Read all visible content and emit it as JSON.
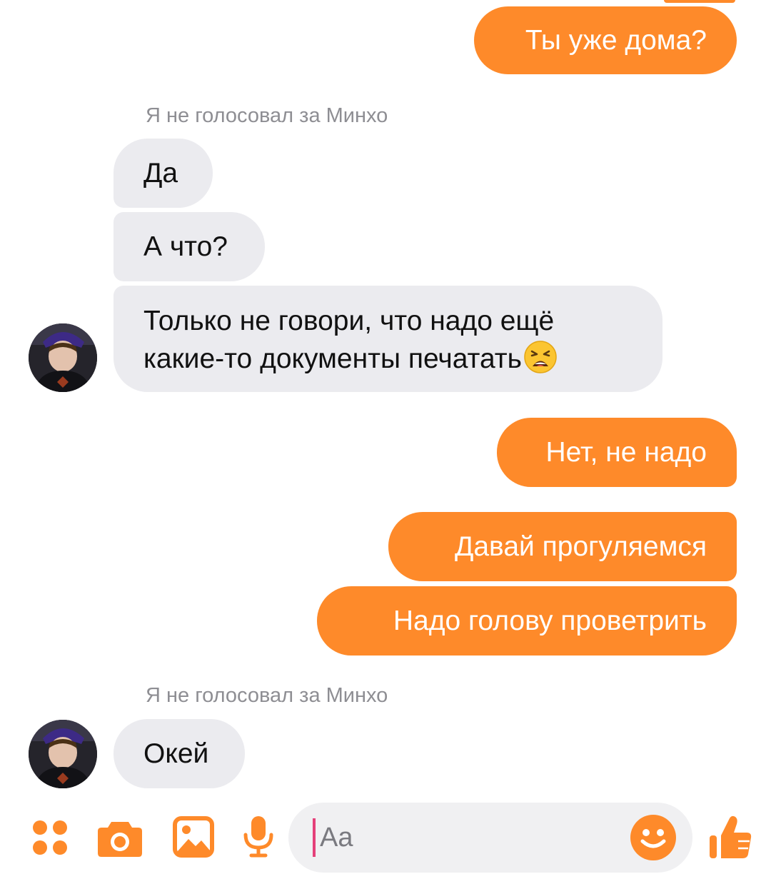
{
  "conversation": {
    "messages": [
      {
        "text": "Ты уже дома?"
      },
      {
        "text": "Да"
      },
      {
        "text": "А что?"
      },
      {
        "line1": "Только не говори, что надо ещё",
        "line2": "какие-то документы печатать",
        "emoji": "weary-face-emoji"
      },
      {
        "text": "Нет, не надо"
      },
      {
        "text": "Давай прогуляемся"
      },
      {
        "text": "Надо голову проветрить"
      },
      {
        "text": "Окей"
      }
    ],
    "sender_label_1": "Я не голосовал за Минхо",
    "sender_label_2": "Я не голосовал за Минхо"
  },
  "composer": {
    "placeholder": "Aa",
    "icons": [
      "apps-icon",
      "camera-icon",
      "gallery-icon",
      "microphone-icon",
      "emoji-icon",
      "thumbs-up-icon"
    ]
  },
  "colors": {
    "accent": "#fe8a2a",
    "incoming_bubble": "#ebebef",
    "sender_label": "#8e8e93"
  }
}
